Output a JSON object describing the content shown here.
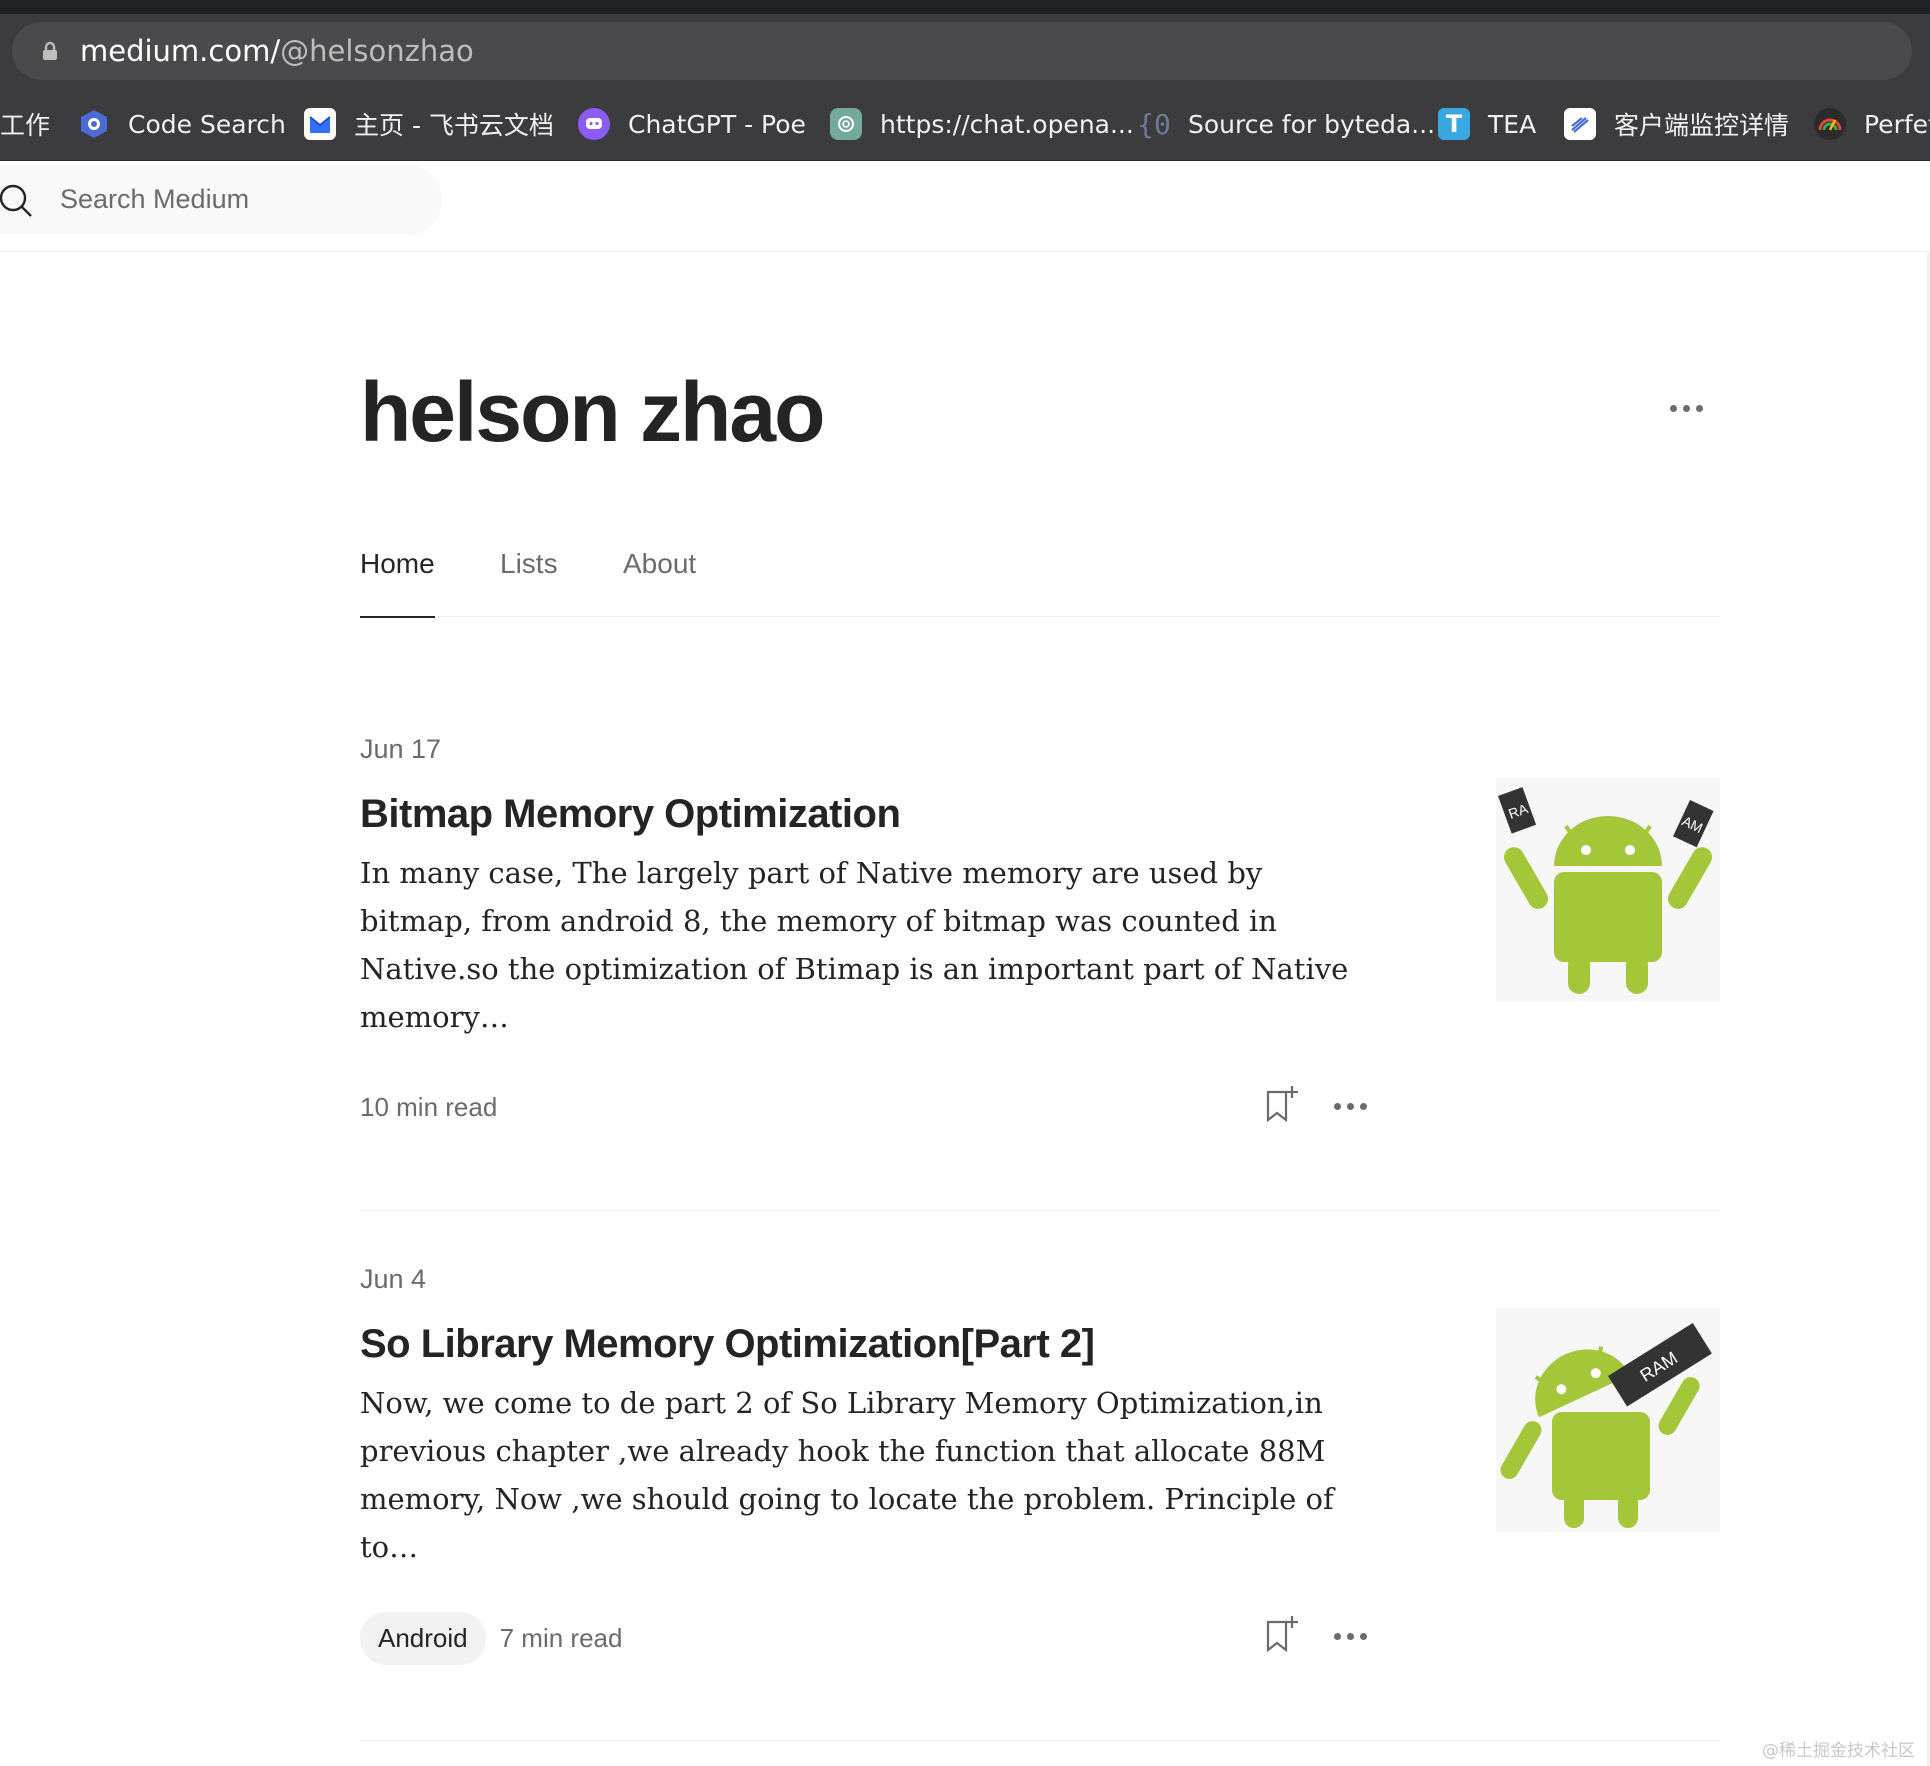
{
  "browser": {
    "url_domain": "medium.com/",
    "url_path": "@helsonzhao",
    "bookmarks": [
      {
        "label": "工作"
      },
      {
        "label": "Code Search"
      },
      {
        "label": "主页 - 飞书云文档"
      },
      {
        "label": "ChatGPT - Poe"
      },
      {
        "label": "https://chat.opena..."
      },
      {
        "label": "Source for byteda..."
      },
      {
        "label": "TEA"
      },
      {
        "label": "客户端监控详情"
      },
      {
        "label": "Perfet"
      }
    ]
  },
  "header": {
    "search_placeholder": "Search Medium"
  },
  "profile": {
    "name": "helson zhao",
    "tabs": [
      {
        "label": "Home",
        "active": true
      },
      {
        "label": "Lists",
        "active": false
      },
      {
        "label": "About",
        "active": false
      }
    ]
  },
  "articles": [
    {
      "date": "Jun 17",
      "title": "Bitmap Memory Optimization",
      "excerpt": "In many case, The largely part of Native memory are used by bitmap, from android 8, the memory of bitmap was counted in Native.so the optimization of Btimap is an important part of Native memory…",
      "tag": "",
      "read_time": "10 min read",
      "thumb_labels": [
        "RA",
        "AM"
      ]
    },
    {
      "date": "Jun 4",
      "title": "So Library Memory Optimization[Part 2]",
      "excerpt": "Now, we come to de part 2 of So Library Memory Optimization,in previous chapter ,we already hook the function that allocate 88M memory, Now ,we should going to locate the problem. Principle of to…",
      "tag": "Android",
      "read_time": "7 min read",
      "thumb_labels": [
        "RAM"
      ]
    }
  ],
  "watermark": "@稀土掘金技术社区",
  "colors": {
    "android_green": "#a4c639",
    "text_primary": "#242424",
    "text_secondary": "#6b6b6b"
  }
}
